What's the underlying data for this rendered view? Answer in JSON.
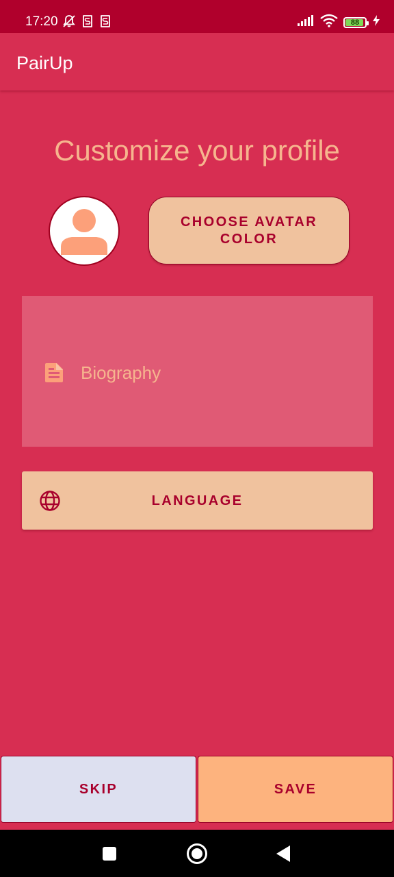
{
  "status_bar": {
    "time": "17:20",
    "battery_level": "88",
    "left_icons": [
      "bell-off-icon",
      "notification-s-icon",
      "notification-s-icon"
    ],
    "right_icons": [
      "signal-icon",
      "wifi-icon",
      "battery-icon",
      "charging-bolt-icon"
    ]
  },
  "app_bar": {
    "title": "PairUp"
  },
  "main": {
    "heading": "Customize your profile",
    "avatar_icon": "person-icon",
    "choose_color_label": "CHOOSE AVATAR COLOR",
    "biography": {
      "icon": "document-icon",
      "placeholder": "Biography",
      "value": ""
    },
    "language": {
      "icon": "globe-icon",
      "label": "LANGUAGE"
    }
  },
  "actions": {
    "skip_label": "SKIP",
    "save_label": "SAVE"
  },
  "nav_bar": {
    "items": [
      "recents-square-icon",
      "home-circle-icon",
      "back-triangle-icon"
    ]
  },
  "colors": {
    "background": "#d72e52",
    "status_bar": "#b0002c",
    "accent_text": "#a8002c",
    "peach": "#f0c29e",
    "title_text": "#f6b58e",
    "bio_field": "#e05a75",
    "skip_button": "#dde0f0",
    "save_button": "#fdb37e",
    "avatar_person": "#fca07a",
    "battery": "#7ed957"
  }
}
